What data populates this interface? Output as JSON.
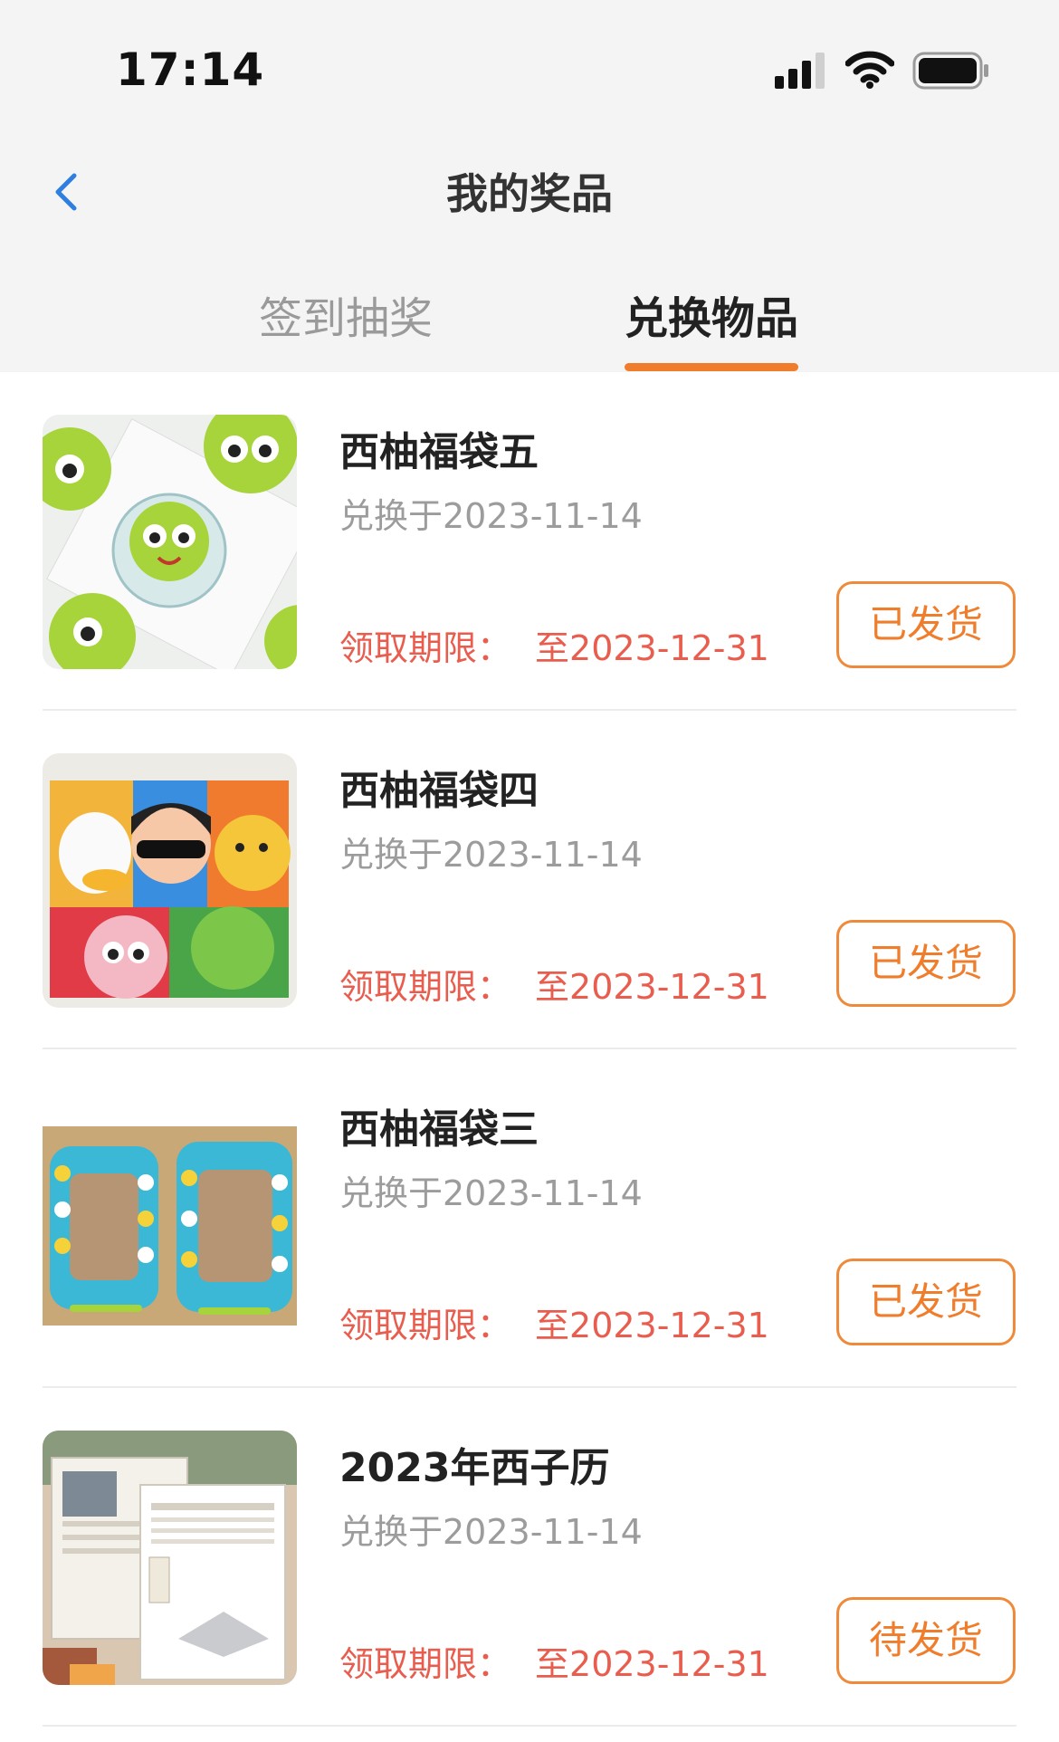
{
  "status_bar": {
    "time": "17:14"
  },
  "nav": {
    "title": "我的奖品"
  },
  "tabs": [
    {
      "label": "签到抽奖",
      "active": false
    },
    {
      "label": "兑换物品",
      "active": true
    }
  ],
  "colors": {
    "accent": "#ef7d2b",
    "deadline": "#e95d4f",
    "background": "#f4f4f4"
  },
  "items": [
    {
      "name": "西柚福袋五",
      "date": "兑换于2023-11-14",
      "deadline_label": "领取期限：",
      "deadline_value": "至2023-12-31",
      "status": "已发货",
      "image": "green-mascot-badge"
    },
    {
      "name": "西柚福袋四",
      "date": "兑换于2023-11-14",
      "deadline_label": "领取期限：",
      "deadline_value": "至2023-12-31",
      "status": "已发货",
      "image": "cartoon-notebooks"
    },
    {
      "name": "西柚福袋三",
      "date": "兑换于2023-11-14",
      "deadline_label": "领取期限：",
      "deadline_value": "至2023-12-31",
      "status": "已发货",
      "image": "cartoon-photo-frames"
    },
    {
      "name": "2023年西子历",
      "date": "兑换于2023-11-14",
      "deadline_label": "领取期限：",
      "deadline_value": "至2023-12-31",
      "status": "待发货",
      "image": "desk-calendar"
    }
  ]
}
